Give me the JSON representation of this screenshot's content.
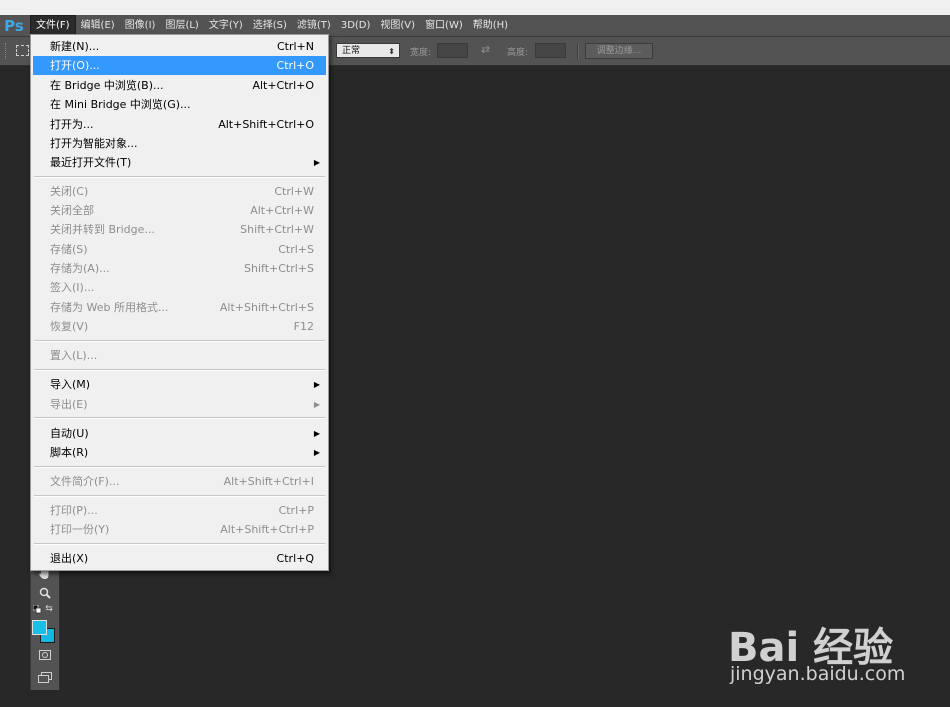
{
  "app": {
    "logo": "Ps"
  },
  "menubar": {
    "items": [
      {
        "label": "文件(F)",
        "active": true
      },
      {
        "label": "编辑(E)"
      },
      {
        "label": "图像(I)"
      },
      {
        "label": "图层(L)"
      },
      {
        "label": "文字(Y)"
      },
      {
        "label": "选择(S)"
      },
      {
        "label": "滤镜(T)"
      },
      {
        "label": "3D(D)"
      },
      {
        "label": "视图(V)"
      },
      {
        "label": "窗口(W)"
      },
      {
        "label": "帮助(H)"
      }
    ]
  },
  "options": {
    "style_value": "正常",
    "width_label": "宽度:",
    "height_label": "高度:",
    "refine_edge": "调整边缘..."
  },
  "file_menu": {
    "items": [
      {
        "label": "新建(N)...",
        "shortcut": "Ctrl+N",
        "enabled": true
      },
      {
        "label": "打开(O)...",
        "shortcut": "Ctrl+O",
        "enabled": true,
        "highlighted": true
      },
      {
        "label": "在 Bridge 中浏览(B)...",
        "shortcut": "Alt+Ctrl+O",
        "enabled": true
      },
      {
        "label": "在 Mini Bridge 中浏览(G)...",
        "shortcut": "",
        "enabled": true
      },
      {
        "label": "打开为...",
        "shortcut": "Alt+Shift+Ctrl+O",
        "enabled": true
      },
      {
        "label": "打开为智能对象...",
        "shortcut": "",
        "enabled": true
      },
      {
        "label": "最近打开文件(T)",
        "shortcut": "",
        "enabled": true,
        "submenu": true
      },
      {
        "label": "关闭(C)",
        "shortcut": "Ctrl+W",
        "enabled": false
      },
      {
        "label": "关闭全部",
        "shortcut": "Alt+Ctrl+W",
        "enabled": false
      },
      {
        "label": "关闭并转到 Bridge...",
        "shortcut": "Shift+Ctrl+W",
        "enabled": false
      },
      {
        "label": "存储(S)",
        "shortcut": "Ctrl+S",
        "enabled": false
      },
      {
        "label": "存储为(A)...",
        "shortcut": "Shift+Ctrl+S",
        "enabled": false
      },
      {
        "label": "签入(I)...",
        "shortcut": "",
        "enabled": false
      },
      {
        "label": "存储为 Web 所用格式...",
        "shortcut": "Alt+Shift+Ctrl+S",
        "enabled": false
      },
      {
        "label": "恢复(V)",
        "shortcut": "F12",
        "enabled": false
      },
      {
        "label": "置入(L)...",
        "shortcut": "",
        "enabled": false
      },
      {
        "label": "导入(M)",
        "shortcut": "",
        "enabled": true,
        "submenu": true
      },
      {
        "label": "导出(E)",
        "shortcut": "",
        "enabled": false,
        "submenu": true
      },
      {
        "label": "自动(U)",
        "shortcut": "",
        "enabled": true,
        "submenu": true
      },
      {
        "label": "脚本(R)",
        "shortcut": "",
        "enabled": true,
        "submenu": true
      },
      {
        "label": "文件简介(F)...",
        "shortcut": "Alt+Shift+Ctrl+I",
        "enabled": false
      },
      {
        "label": "打印(P)...",
        "shortcut": "Ctrl+P",
        "enabled": false
      },
      {
        "label": "打印一份(Y)",
        "shortcut": "Alt+Shift+Ctrl+P",
        "enabled": false
      },
      {
        "label": "退出(X)",
        "shortcut": "Ctrl+Q",
        "enabled": true
      }
    ]
  },
  "colors": {
    "foreground": "#16c0e8",
    "background": "#12b8e2",
    "highlight": "#3399ff"
  },
  "watermark": {
    "brand": "Bai 经验",
    "url": "jingyan.baidu.com"
  }
}
